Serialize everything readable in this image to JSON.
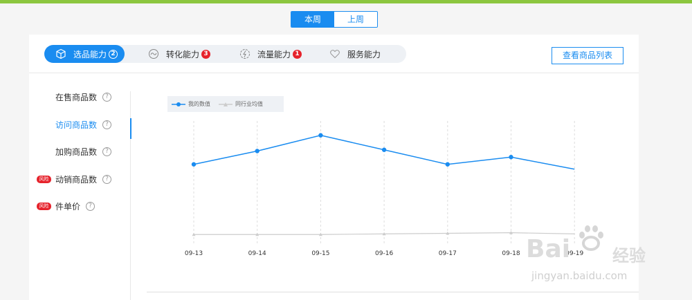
{
  "week_toggle": [
    {
      "label": "本周",
      "active": true
    },
    {
      "label": "上周",
      "active": false
    }
  ],
  "tabs": [
    {
      "label": "选品能力",
      "badge": "2",
      "icon": "cube-icon",
      "active": true
    },
    {
      "label": "转化能力",
      "badge": "3",
      "icon": "wave-icon",
      "active": false
    },
    {
      "label": "流量能力",
      "badge": "1",
      "icon": "flow-icon",
      "active": false
    },
    {
      "label": "服务能力",
      "badge": "",
      "icon": "heart-icon",
      "active": false
    }
  ],
  "list_button": "查看商品列表",
  "metrics": [
    {
      "label": "在售商品数",
      "risk": "",
      "active": false
    },
    {
      "label": "访问商品数",
      "risk": "",
      "active": true
    },
    {
      "label": "加购商品数",
      "risk": "",
      "active": false
    },
    {
      "label": "动销商品数",
      "risk": "风险",
      "active": false
    },
    {
      "label": "件单价",
      "risk": "风险",
      "active": false
    }
  ],
  "help_glyph": "?",
  "colors": {
    "accent": "#1a8cf0",
    "badge": "#e6232c",
    "top_strip": "#8cc63f",
    "industry_line": "#cccccc"
  },
  "chart_data": {
    "type": "line",
    "categories": [
      "09-13",
      "09-14",
      "09-15",
      "09-16",
      "09-17",
      "09-18",
      "09-19"
    ],
    "series": [
      {
        "name": "我的数值",
        "color": "#1a8cf0",
        "values": [
          67,
          78,
          91,
          79,
          67,
          73,
          63
        ]
      },
      {
        "name": "同行业均值",
        "color": "#cccccc",
        "values": [
          9,
          9,
          9,
          9.5,
          10,
          10.5,
          9.5
        ]
      }
    ],
    "ylim": [
      0,
      100
    ],
    "grid": "vertical dashed",
    "legend": "top-left"
  },
  "watermark": {
    "brand": "Bai",
    "brand2": "经验",
    "url": "jingyan.baidu.com"
  }
}
